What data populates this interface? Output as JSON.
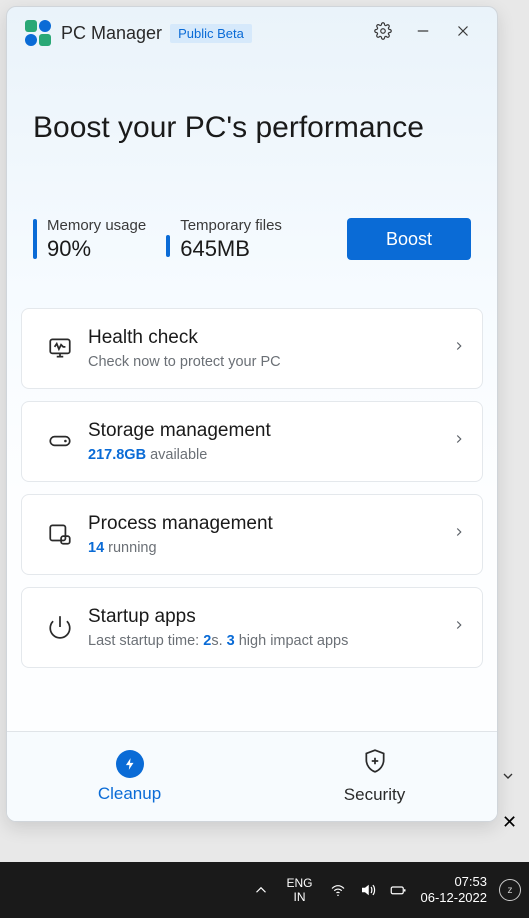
{
  "titlebar": {
    "app_name": "PC Manager",
    "badge": "Public Beta"
  },
  "hero": {
    "headline": "Boost your PC's performance",
    "memory_label": "Memory usage",
    "memory_value": "90%",
    "temp_label": "Temporary files",
    "temp_value": "645MB",
    "boost_label": "Boost"
  },
  "cards": {
    "health": {
      "title": "Health check",
      "subtitle": "Check now to protect your PC"
    },
    "storage": {
      "title": "Storage management",
      "value": "217.8GB",
      "suffix": " available"
    },
    "process": {
      "title": "Process management",
      "value": "14",
      "suffix": " running"
    },
    "startup": {
      "title": "Startup apps",
      "prefix": "Last startup time: ",
      "v1": "2",
      "mid": "s. ",
      "v2": "3",
      "suffix": " high impact apps"
    }
  },
  "nav": {
    "cleanup": "Cleanup",
    "security": "Security"
  },
  "taskbar": {
    "lang1": "ENG",
    "lang2": "IN",
    "time": "07:53",
    "date": "06-12-2022"
  }
}
